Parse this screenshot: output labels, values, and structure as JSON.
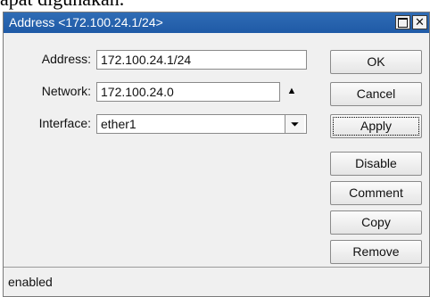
{
  "background": {
    "caption_fragment": "apat digunakan."
  },
  "window": {
    "title": "Address <172.100.24.1/24>",
    "maximize_icon": "maximize-icon",
    "close_glyph": "✕"
  },
  "form": {
    "address": {
      "label": "Address:",
      "value": "172.100.24.1/24"
    },
    "network": {
      "label": "Network:",
      "value": "172.100.24.0",
      "arrow": "▲"
    },
    "interface": {
      "label": "Interface:",
      "value": "ether1",
      "dropdown_glyph": "⏷"
    }
  },
  "buttons": {
    "ok": "OK",
    "cancel": "Cancel",
    "apply": "Apply",
    "disable": "Disable",
    "comment": "Comment",
    "copy": "Copy",
    "remove": "Remove"
  },
  "status": {
    "text": "enabled"
  },
  "colors": {
    "titlebar": "#2a66b0",
    "window_bg": "#f0f0f0"
  }
}
